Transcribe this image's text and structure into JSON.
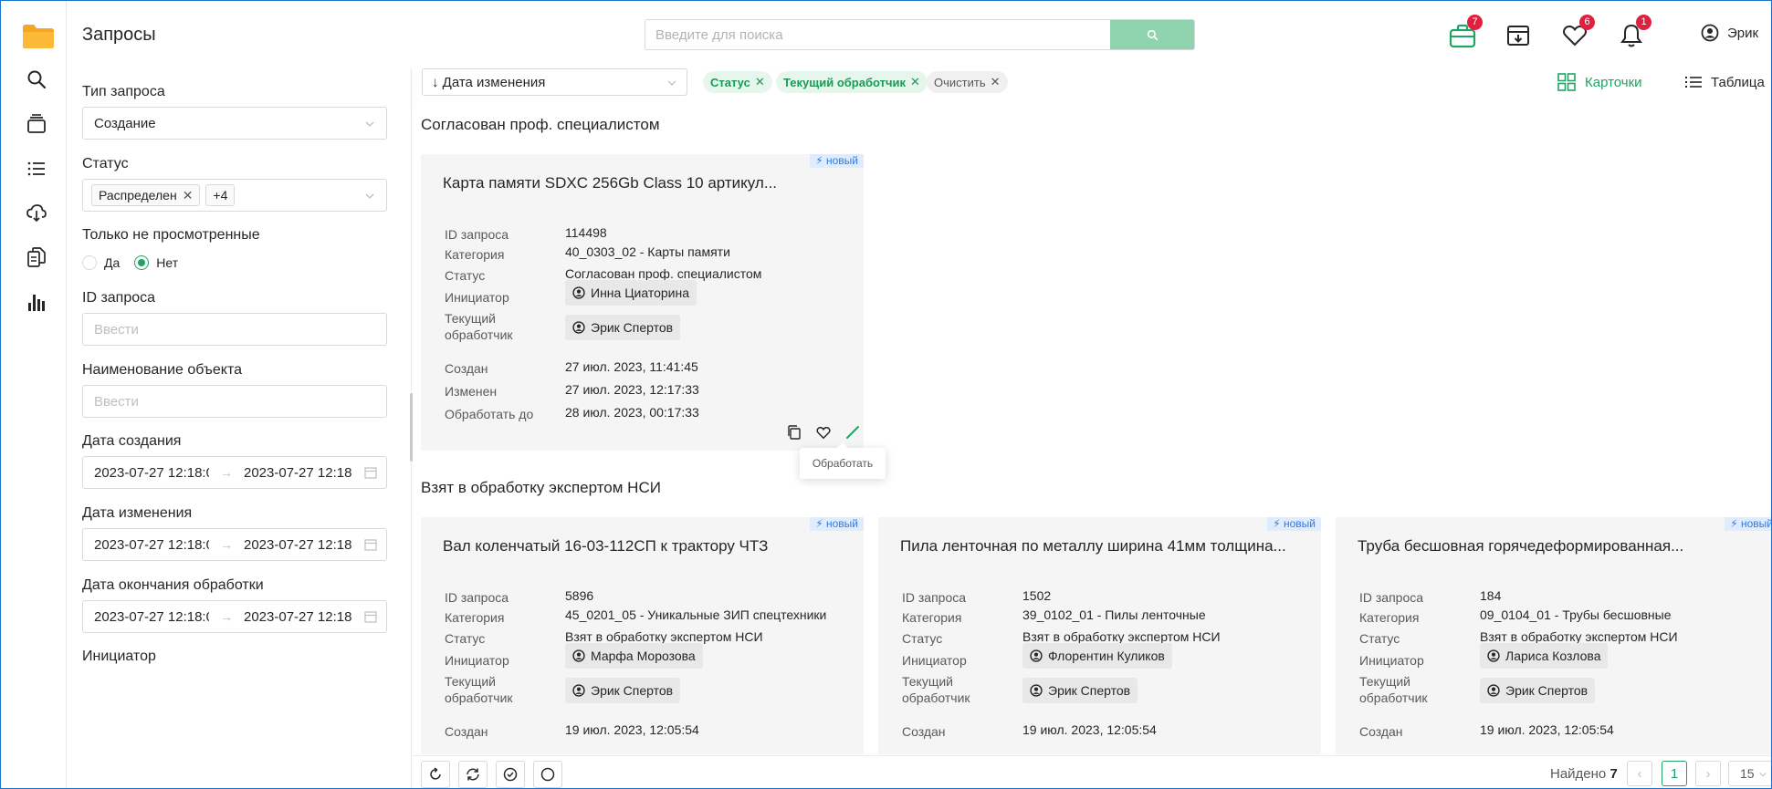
{
  "app": {
    "title": "Запросы",
    "user_name": "Эрик"
  },
  "search": {
    "placeholder": "Введите для поиска"
  },
  "topbar": {
    "badges": {
      "cases": "7",
      "favorites": "6",
      "notifications": "1"
    }
  },
  "filters": {
    "request_type": {
      "label": "Тип запроса",
      "value": "Создание"
    },
    "status": {
      "label": "Статус",
      "tag": "Распределен",
      "more": "+4"
    },
    "unviewed": {
      "label": "Только не просмотренные",
      "yes": "Да",
      "no": "Нет",
      "selected": "Нет"
    },
    "request_id": {
      "label": "ID запроса",
      "placeholder": "Ввести"
    },
    "object_name": {
      "label": "Наименование объекта",
      "placeholder": "Ввести"
    },
    "created": {
      "label": "Дата создания",
      "from": "2023-07-27 12:18:0",
      "to": "2023-07-27 12:18"
    },
    "modified": {
      "label": "Дата изменения",
      "from": "2023-07-27 12:18:0",
      "to": "2023-07-27 12:18"
    },
    "deadline": {
      "label": "Дата окончания обработки",
      "from": "2023-07-27 12:18:0",
      "to": "2023-07-27 12:18"
    },
    "initiator": {
      "label": "Инициатор"
    }
  },
  "toolbar": {
    "sort_label": "↓ Дата изменения",
    "chips": {
      "status": "Статус",
      "handler": "Текущий обработчик",
      "clear": "Очистить"
    },
    "view_cards": "Карточки",
    "view_table": "Таблица"
  },
  "field_labels": {
    "id": "ID запроса",
    "category": "Категория",
    "status": "Статус",
    "initiator": "Инициатор",
    "handler_1": "Текущий",
    "handler_2": "обработчик",
    "created": "Создан",
    "modified": "Изменен",
    "deadline": "Обработать до"
  },
  "new_label": "новый",
  "groups": [
    {
      "title": "Согласован проф. специалистом",
      "cards": [
        {
          "title": "Карта памяти SDXC 256Gb Class 10 артикул...",
          "id": "114498",
          "category": "40_0303_02 - Карты памяти",
          "status": "Согласован проф. специалистом",
          "initiator": "Инна Циаторина",
          "handler": "Эрик Спертов",
          "created": "27 июл. 2023, 11:41:45",
          "modified": "27 июл. 2023, 12:17:33",
          "deadline": "28 июл. 2023, 00:17:33"
        }
      ]
    },
    {
      "title": "Взят в обработку экспертом НСИ",
      "cards": [
        {
          "title": "Вал коленчатый 16-03-112СП к трактору ЧТЗ",
          "id": "5896",
          "category": "45_0201_05 - Уникальные ЗИП спецтехники",
          "status": "Взят в обработку экспертом НСИ",
          "initiator": "Марфа Морозова",
          "handler": "Эрик Спертов",
          "created": "19 июл. 2023, 12:05:54"
        },
        {
          "title": "Пила ленточная по металлу ширина 41мм толщина...",
          "id": "1502",
          "category": "39_0102_01 - Пилы ленточные",
          "status": "Взят в обработку экспертом НСИ",
          "initiator": "Флорентин Куликов",
          "handler": "Эрик Спертов",
          "created": "19 июл. 2023, 12:05:54"
        },
        {
          "title": "Труба бесшовная горячедеформированная...",
          "id": "184",
          "category": "09_0104_01 - Трубы бесшовные",
          "status": "Взят в обработку экспертом НСИ",
          "initiator": "Лариса Козлова",
          "handler": "Эрик Спертов",
          "created": "19 июл. 2023, 12:05:54"
        }
      ]
    }
  ],
  "tooltip": "Обработать",
  "footer": {
    "found_label": "Найдено",
    "found_count": "7",
    "page": "1",
    "page_size": "15"
  },
  "colors": {
    "accent": "#21a366",
    "badge": "#e0203f",
    "folder": "#f5a623",
    "new_tag_bg": "#deecff",
    "card_bg": "#f5f5f5"
  }
}
